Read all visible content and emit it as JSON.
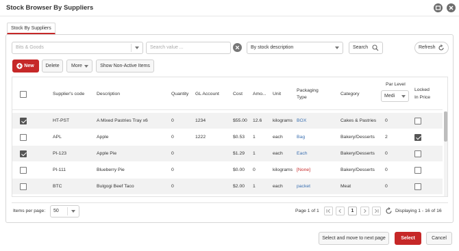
{
  "window": {
    "title": "Stock Browser By Suppliers",
    "maximize_icon": "maximize-icon",
    "close_icon": "close-icon"
  },
  "tabs": [
    {
      "label": "Stock By Suppliers",
      "active": true
    }
  ],
  "filters": {
    "supplier_placeholder": "Bits & Goods",
    "search_placeholder": "Search value ...",
    "search_by": "By stock description",
    "search_button": "Search",
    "refresh_button": "Refresh"
  },
  "toolbar": {
    "new": "New",
    "delete": "Delete",
    "more": "More",
    "show_non_active": "Show Non-Active Items"
  },
  "columns": {
    "code": "Supplier's code",
    "description": "Description",
    "quantity": "Quantity",
    "gl_account": "GL Account",
    "cost": "Cost",
    "amount": "Amo...",
    "unit": "Unit",
    "packaging_1": "Packaging",
    "packaging_2": "Type",
    "category": "Category",
    "par_level": "Par Level",
    "par_level_select": "Medi",
    "locked_1": "Locked",
    "locked_2": "In Price"
  },
  "rows": [
    {
      "checked": true,
      "code": "HT-PST",
      "description": "A Mixed Pastries Tray x6",
      "quantity": "0",
      "gl": "1234",
      "cost": "$55.00",
      "amount": "12.6",
      "unit": "kilograms",
      "packaging": "BOX",
      "category": "Cakes & Pastries",
      "par": "0",
      "locked": false
    },
    {
      "checked": false,
      "code": "APL",
      "description": "Apple",
      "quantity": "0",
      "gl": "1222",
      "cost": "$0.53",
      "amount": "1",
      "unit": "each",
      "packaging": "Bag",
      "category": "Bakery/Desserts",
      "par": "2",
      "locked": true
    },
    {
      "checked": true,
      "code": "PI-123",
      "description": "Apple Pie",
      "quantity": "0",
      "gl": "",
      "cost": "$1.29",
      "amount": "1",
      "unit": "each",
      "packaging": "Each",
      "category": "Bakery/Desserts",
      "par": "0",
      "locked": false
    },
    {
      "checked": false,
      "code": "PI-111",
      "description": "Blueberry Pie",
      "quantity": "0",
      "gl": "",
      "cost": "$0.00",
      "amount": "0",
      "unit": "kilograms",
      "packaging": "[None]",
      "category": "Bakery/Desserts",
      "par": "0",
      "locked": false
    },
    {
      "checked": false,
      "code": "BTC",
      "description": "Bulgogi Beef Taco",
      "quantity": "0",
      "gl": "",
      "cost": "$2.00",
      "amount": "1",
      "unit": "each",
      "packaging": "packet",
      "category": "Meat",
      "par": "0",
      "locked": false
    }
  ],
  "pager": {
    "items_per_page_label": "Items per page:",
    "items_per_page": "50",
    "page_text": "Page 1 of 1",
    "current_page": "1",
    "displaying": "Displaying 1 - 16 of 16"
  },
  "footer": {
    "select_next": "Select and move to next page",
    "select": "Select",
    "cancel": "Cancel"
  },
  "colors": {
    "accent": "#c62828",
    "link": "#3a6fb0"
  }
}
